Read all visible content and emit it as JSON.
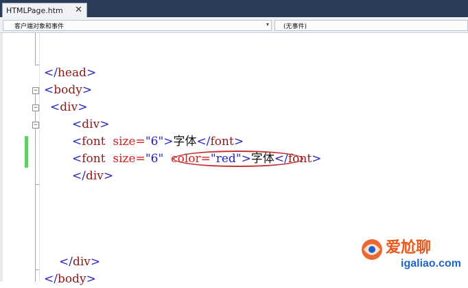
{
  "tab": {
    "title": "HTMLPage.htm",
    "close_glyph": "✕"
  },
  "nav": {
    "left_dropdown": "客户端对象和事件",
    "right_dropdown": "(无事件)",
    "arrow_glyph": "▾"
  },
  "fold": {
    "collapse_glyph": "−"
  },
  "code": {
    "l1": {
      "open": "</",
      "tag": "head",
      "close": ">"
    },
    "l2": {
      "open": "<",
      "tag": "body",
      "close": ">"
    },
    "l3": {
      "open": "<",
      "tag": "div",
      "close": ">"
    },
    "l4": {
      "open": "<",
      "tag": "div",
      "close": ">"
    },
    "l5": {
      "open": "<",
      "tag": "font",
      "attr": "size=",
      "value": "\"6\"",
      "close": ">",
      "text": "字体",
      "end_open": "</",
      "end_tag": "font",
      "end_close": ">"
    },
    "l6": {
      "open": "<",
      "tag": "font",
      "attr1": "size=",
      "value1": "\"6\"",
      "attr2": "color=",
      "value2": "\"red\"",
      "close": ">",
      "text": "字体",
      "end_open": "</",
      "end_tag": "font",
      "end_close": ">"
    },
    "l7": {
      "open": "</",
      "tag": "div",
      "close": ">"
    },
    "l8": {
      "open": "</",
      "tag": "div",
      "close": ">"
    },
    "l9": {
      "open": "</",
      "tag": "body",
      "close": ">"
    }
  },
  "watermark": {
    "logo_text": "爱尬聊",
    "domain": "igaliao.com",
    "colors": [
      "#e8581c",
      "#1d63c8"
    ]
  }
}
